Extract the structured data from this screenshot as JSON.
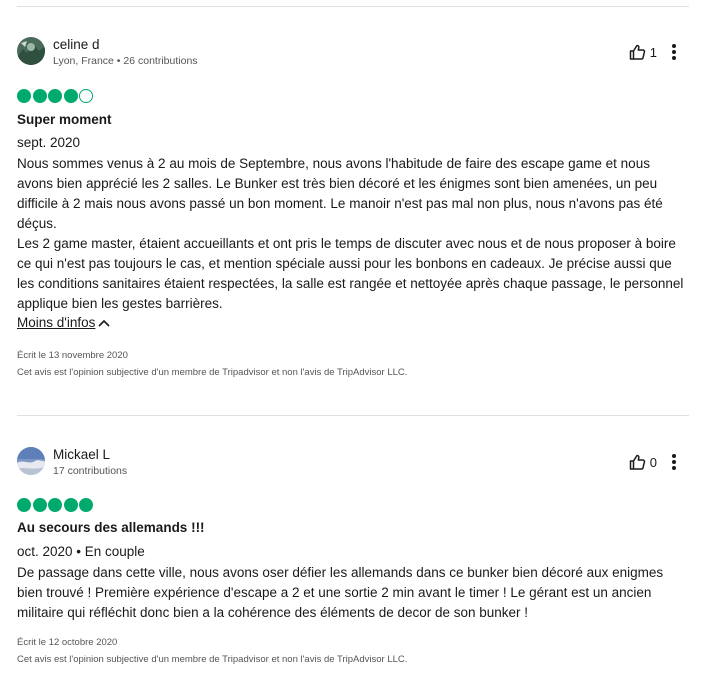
{
  "reviews": [
    {
      "user_name": "celine d",
      "user_meta": "Lyon, France • 26 contributions",
      "helpful_count": "1",
      "rating": 4,
      "rating_max": 5,
      "title": "Super moment",
      "date_line": "sept. 2020",
      "body": "Nous sommes venus à 2 au mois de Septembre, nous avons l'habitude de faire des escape game et nous avons bien apprécié les 2 salles. Le Bunker est très bien décoré et les énigmes sont bien amenées, un peu difficile à 2 mais nous avons passé un bon moment. Le manoir n'est pas mal non plus, nous n'avons pas été déçus.\nLes 2 game master, étaient accueillants et ont pris le temps de discuter avec nous et de nous proposer à boire ce qui n'est pas toujours le cas, et mention spéciale aussi pour les bonbons en cadeaux. Je précise aussi que les conditions sanitaires étaient respectées, la salle est rangée et nettoyée après chaque passage, le personnel applique bien les gestes barrières.",
      "less_label": "Moins d'infos",
      "written": "Écrit le 13 novembre 2020",
      "disclaimer": "Cet avis est l'opinion subjective d'un membre de Tripadvisor et non l'avis de TripAdvisor LLC."
    },
    {
      "user_name": "Mickael L",
      "user_meta": "17 contributions",
      "helpful_count": "0",
      "rating": 5,
      "rating_max": 5,
      "title": "Au secours des allemands !!!",
      "date_line": "oct. 2020 • En couple",
      "body": "De passage dans cette ville, nous avons oser défier les allemands dans ce bunker bien décoré aux enigmes bien trouvé ! Première expérience d'escape a 2 et une sortie 2 min avant le timer ! Le gérant est un ancien militaire qui réfléchit donc bien a la cohérence des éléments de decor de son bunker !",
      "written": "Écrit le 12 octobre 2020",
      "disclaimer": "Cet avis est l'opinion subjective d'un membre de Tripadvisor et non l'avis de TripAdvisor LLC."
    }
  ],
  "colors": {
    "rating_green": "#00aa6c",
    "divider": "#e0e0e0"
  },
  "icons": {
    "helpful": "thumbs-up-icon",
    "more": "more-vertical-icon",
    "collapse": "chevron-up-icon"
  }
}
